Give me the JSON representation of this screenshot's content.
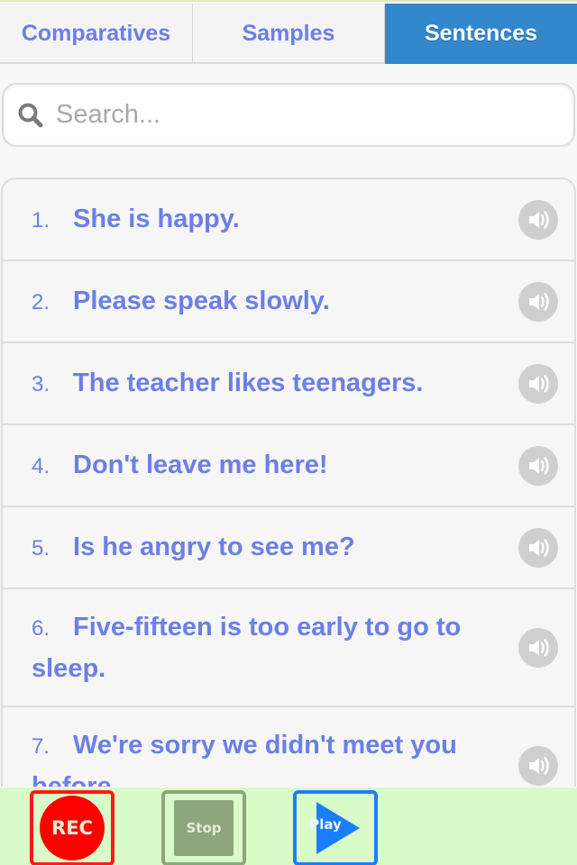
{
  "tabs": [
    {
      "label": "Comparatives",
      "active": false
    },
    {
      "label": "Samples",
      "active": false
    },
    {
      "label": "Sentences",
      "active": true
    }
  ],
  "search": {
    "placeholder": "Search...",
    "value": "",
    "icon": "search-icon"
  },
  "sentences": [
    {
      "number": "1.",
      "text": "She is happy.",
      "icon": "speaker-icon"
    },
    {
      "number": "2.",
      "text": "Please speak slowly.",
      "icon": "speaker-icon"
    },
    {
      "number": "3.",
      "text": "The teacher likes teenagers.",
      "icon": "speaker-icon"
    },
    {
      "number": "4.",
      "text": "Don't leave me here!",
      "icon": "speaker-icon"
    },
    {
      "number": "5.",
      "text": "Is he angry to see me?",
      "icon": "speaker-icon"
    },
    {
      "number": "6.",
      "text": "Five-fifteen is too early to go to sleep.",
      "icon": "speaker-icon"
    },
    {
      "number": "7.",
      "text": "We're sorry we didn't meet you before.",
      "icon": "speaker-icon"
    }
  ],
  "toolbar": {
    "rec_label": "REC",
    "stop_label": "Stop",
    "play_label": "Play"
  },
  "colors": {
    "accent": "#3388cc",
    "link_text": "#6b7fe6",
    "toolbar_bg": "#d8fbc8",
    "rec": "#ff0000",
    "stop": "#8ea67c",
    "play": "#1a7fff"
  }
}
